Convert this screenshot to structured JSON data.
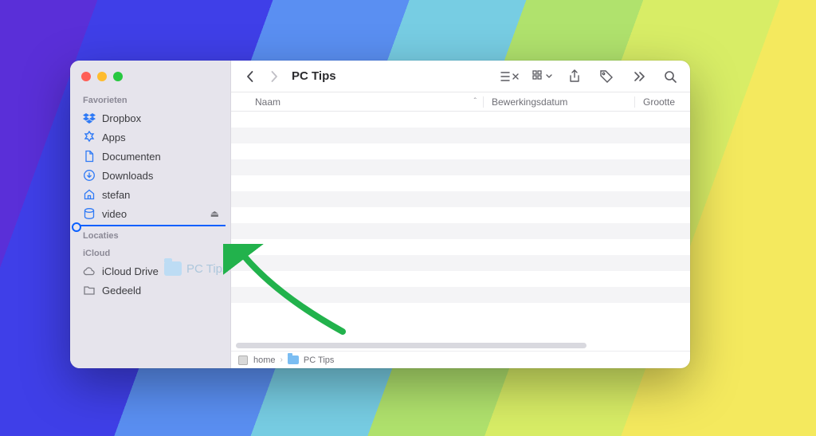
{
  "colors": {
    "accent": "#0a60ff"
  },
  "sidebar": {
    "sections": {
      "favorites_label": "Favorieten",
      "locations_label": "Locaties",
      "icloud_label": "iCloud"
    },
    "favorites": [
      {
        "label": "Dropbox",
        "icon": "dropbox-icon"
      },
      {
        "label": "Apps",
        "icon": "apps-icon"
      },
      {
        "label": "Documenten",
        "icon": "document-icon"
      },
      {
        "label": "Downloads",
        "icon": "downloads-icon"
      },
      {
        "label": "stefan",
        "icon": "home-icon"
      },
      {
        "label": "video",
        "icon": "disk-icon",
        "ejectable": true
      }
    ],
    "icloud": [
      {
        "label": "iCloud Drive",
        "icon": "cloud-icon"
      },
      {
        "label": "Gedeeld",
        "icon": "shared-folder-icon"
      }
    ]
  },
  "drag_ghost": {
    "label": "PC Tips"
  },
  "toolbar": {
    "title": "PC Tips"
  },
  "columns": {
    "name": "Naam",
    "date": "Bewerkingsdatum",
    "size": "Grootte"
  },
  "pathbar": {
    "segments": [
      {
        "label": "home",
        "icon": "disk"
      },
      {
        "label": "PC Tips",
        "icon": "folder"
      }
    ]
  }
}
